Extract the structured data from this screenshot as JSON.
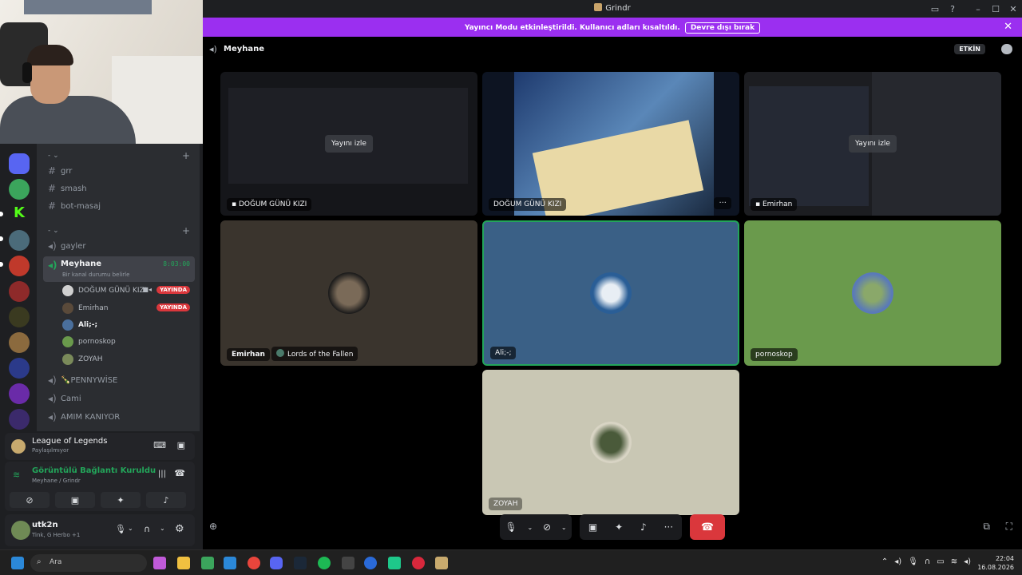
{
  "window": {
    "title": "Grindr"
  },
  "banner": {
    "message": "Yayıncı Modu etkinleştirildi. Kullanıcı adları kısaltıldı.",
    "button": "Devre dışı bırak"
  },
  "channels": {
    "top_channels": [
      "grr",
      "smash",
      "bot-masaj"
    ],
    "voice_channels": [
      "gayler"
    ],
    "active": {
      "name": "Meyhane",
      "time": "8:03:00",
      "status": "Bir kanal durumu belirle"
    },
    "users": [
      {
        "name": "DOĞUM GÜNÜ KIZI",
        "live": "YAYINDA"
      },
      {
        "name": "Emirhan",
        "live": "YAYINDA"
      },
      {
        "name": "Ali;-;"
      },
      {
        "name": "pornoskop"
      },
      {
        "name": "ZOYAH"
      }
    ],
    "more_voice": [
      "🍾PENNYWİSE",
      "Cami",
      "AMIM KANIYOR"
    ]
  },
  "game": {
    "title": "League of Legends",
    "subtitle": "Paylaşılmıyor"
  },
  "connection": {
    "title": "Görüntülü Bağlantı Kuruldu",
    "subtitle": "Meyhane / Grindr"
  },
  "profile": {
    "name": "utk2n",
    "status": "Tink, G Herbo +1"
  },
  "main": {
    "channel": "Meyhane",
    "activity_badge": "ETKİN",
    "tiles": [
      {
        "label": "DOĞUM GÜNÜ KIZI",
        "watch": "Yayını izle"
      },
      {
        "label": "DOĞUM GÜNÜ KIZI"
      },
      {
        "label": "Emirhan",
        "watch": "Yayını izle"
      },
      {
        "label": "Emirhan",
        "activity": "Lords of the Fallen"
      },
      {
        "label": "Ali;-;"
      },
      {
        "label": "pornoskop"
      },
      {
        "label": "ZOYAH"
      }
    ]
  },
  "taskbar": {
    "search": "Ara",
    "time": "22:04",
    "date": "16.08.2026"
  },
  "colors": {
    "banner": "#9b2ff0",
    "live": "#da373c",
    "connected": "#23a55a",
    "speaking_border": "#23a55a"
  }
}
